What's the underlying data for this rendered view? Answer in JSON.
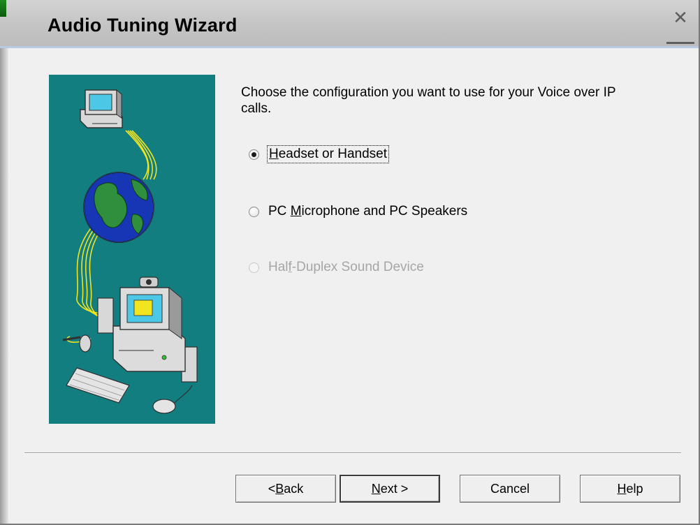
{
  "window": {
    "title": "Audio Tuning Wizard",
    "close_glyph": "✕",
    "close_icon": "close-icon"
  },
  "illustration": {
    "background_color": "#127e80",
    "icons": [
      "network-computer-icon",
      "globe-icon",
      "desktop-computer-icon"
    ]
  },
  "prompt": "Choose the configuration you want to use for your Voice over IP calls.",
  "options": [
    {
      "pre": "",
      "key": "H",
      "post": "eadset or Handset",
      "selected": true,
      "enabled": true
    },
    {
      "pre": "PC ",
      "key": "M",
      "post": "icrophone and PC Speakers",
      "selected": false,
      "enabled": true
    },
    {
      "pre": "Hal",
      "key": "f",
      "post": "-Duplex Sound Device",
      "selected": false,
      "enabled": false
    }
  ],
  "buttons": {
    "back": {
      "pre": "< ",
      "key": "B",
      "post": "ack"
    },
    "next": {
      "pre": "",
      "key": "N",
      "post": "ext >"
    },
    "cancel": {
      "label": "Cancel"
    },
    "help": {
      "pre": "",
      "key": "H",
      "post": "elp"
    }
  }
}
